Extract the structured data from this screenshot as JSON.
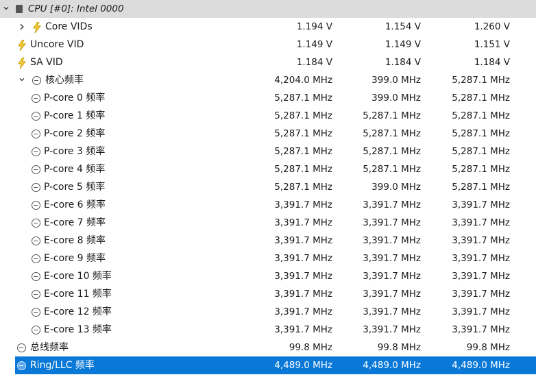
{
  "icons": {
    "volt": "lightning-bolt-icon",
    "clock": "clock-icon",
    "chip": "chip-icon",
    "expand": "chevron-right-icon",
    "collapse": "chevron-down-icon"
  },
  "colors": {
    "header_bg": "#dcdcdc",
    "selected_bg": "#0a78d7",
    "bolt": "#e9b800",
    "icon_gray": "#555555"
  },
  "rows": [
    {
      "label": "CPU [#0]: Intel 0000",
      "type": "header",
      "icon": "chip",
      "chevron": "v",
      "indent": 0,
      "v1": "",
      "v2": "",
      "v3": ""
    },
    {
      "label": "Core VIDs",
      "type": "group",
      "icon": "volt",
      "chevron": ">",
      "indent": 1,
      "v1": "1.194 V",
      "v2": "1.154 V",
      "v3": "1.260 V"
    },
    {
      "label": "Uncore VID",
      "type": "item",
      "icon": "volt",
      "indent": 0,
      "v1": "1.149 V",
      "v2": "1.149 V",
      "v3": "1.151 V"
    },
    {
      "label": "SA VID",
      "type": "item",
      "icon": "volt",
      "indent": 0,
      "v1": "1.184 V",
      "v2": "1.184 V",
      "v3": "1.184 V"
    },
    {
      "label": "核心频率",
      "type": "group",
      "icon": "clock",
      "chevron": "v",
      "indent": 1,
      "v1": "4,204.0 MHz",
      "v2": "399.0 MHz",
      "v3": "5,287.1 MHz"
    },
    {
      "label": "P-core 0 频率",
      "type": "item",
      "icon": "clock",
      "indent": 2,
      "v1": "5,287.1 MHz",
      "v2": "399.0 MHz",
      "v3": "5,287.1 MHz"
    },
    {
      "label": "P-core 1 频率",
      "type": "item",
      "icon": "clock",
      "indent": 2,
      "v1": "5,287.1 MHz",
      "v2": "5,287.1 MHz",
      "v3": "5,287.1 MHz"
    },
    {
      "label": "P-core 2 频率",
      "type": "item",
      "icon": "clock",
      "indent": 2,
      "v1": "5,287.1 MHz",
      "v2": "5,287.1 MHz",
      "v3": "5,287.1 MHz"
    },
    {
      "label": "P-core 3 频率",
      "type": "item",
      "icon": "clock",
      "indent": 2,
      "v1": "5,287.1 MHz",
      "v2": "5,287.1 MHz",
      "v3": "5,287.1 MHz"
    },
    {
      "label": "P-core 4 频率",
      "type": "item",
      "icon": "clock",
      "indent": 2,
      "v1": "5,287.1 MHz",
      "v2": "5,287.1 MHz",
      "v3": "5,287.1 MHz"
    },
    {
      "label": "P-core 5 频率",
      "type": "item",
      "icon": "clock",
      "indent": 2,
      "v1": "5,287.1 MHz",
      "v2": "399.0 MHz",
      "v3": "5,287.1 MHz"
    },
    {
      "label": "E-core 6 频率",
      "type": "item",
      "icon": "clock",
      "indent": 2,
      "v1": "3,391.7 MHz",
      "v2": "3,391.7 MHz",
      "v3": "3,391.7 MHz"
    },
    {
      "label": "E-core 7 频率",
      "type": "item",
      "icon": "clock",
      "indent": 2,
      "v1": "3,391.7 MHz",
      "v2": "3,391.7 MHz",
      "v3": "3,391.7 MHz"
    },
    {
      "label": "E-core 8 频率",
      "type": "item",
      "icon": "clock",
      "indent": 2,
      "v1": "3,391.7 MHz",
      "v2": "3,391.7 MHz",
      "v3": "3,391.7 MHz"
    },
    {
      "label": "E-core 9 频率",
      "type": "item",
      "icon": "clock",
      "indent": 2,
      "v1": "3,391.7 MHz",
      "v2": "3,391.7 MHz",
      "v3": "3,391.7 MHz"
    },
    {
      "label": "E-core 10 频率",
      "type": "item",
      "icon": "clock",
      "indent": 2,
      "v1": "3,391.7 MHz",
      "v2": "3,391.7 MHz",
      "v3": "3,391.7 MHz"
    },
    {
      "label": "E-core 11 频率",
      "type": "item",
      "icon": "clock",
      "indent": 2,
      "v1": "3,391.7 MHz",
      "v2": "3,391.7 MHz",
      "v3": "3,391.7 MHz"
    },
    {
      "label": "E-core 12 频率",
      "type": "item",
      "icon": "clock",
      "indent": 2,
      "v1": "3,391.7 MHz",
      "v2": "3,391.7 MHz",
      "v3": "3,391.7 MHz"
    },
    {
      "label": "E-core 13 频率",
      "type": "item",
      "icon": "clock",
      "indent": 2,
      "v1": "3,391.7 MHz",
      "v2": "3,391.7 MHz",
      "v3": "3,391.7 MHz"
    },
    {
      "label": "总线频率",
      "type": "item",
      "icon": "clock",
      "indent": 0,
      "v1": "99.8 MHz",
      "v2": "99.8 MHz",
      "v3": "99.8 MHz"
    },
    {
      "label": "Ring/LLC 频率",
      "type": "item",
      "icon": "clock",
      "indent": 0,
      "selected": true,
      "v1": "4,489.0 MHz",
      "v2": "4,489.0 MHz",
      "v3": "4,489.0 MHz"
    }
  ]
}
